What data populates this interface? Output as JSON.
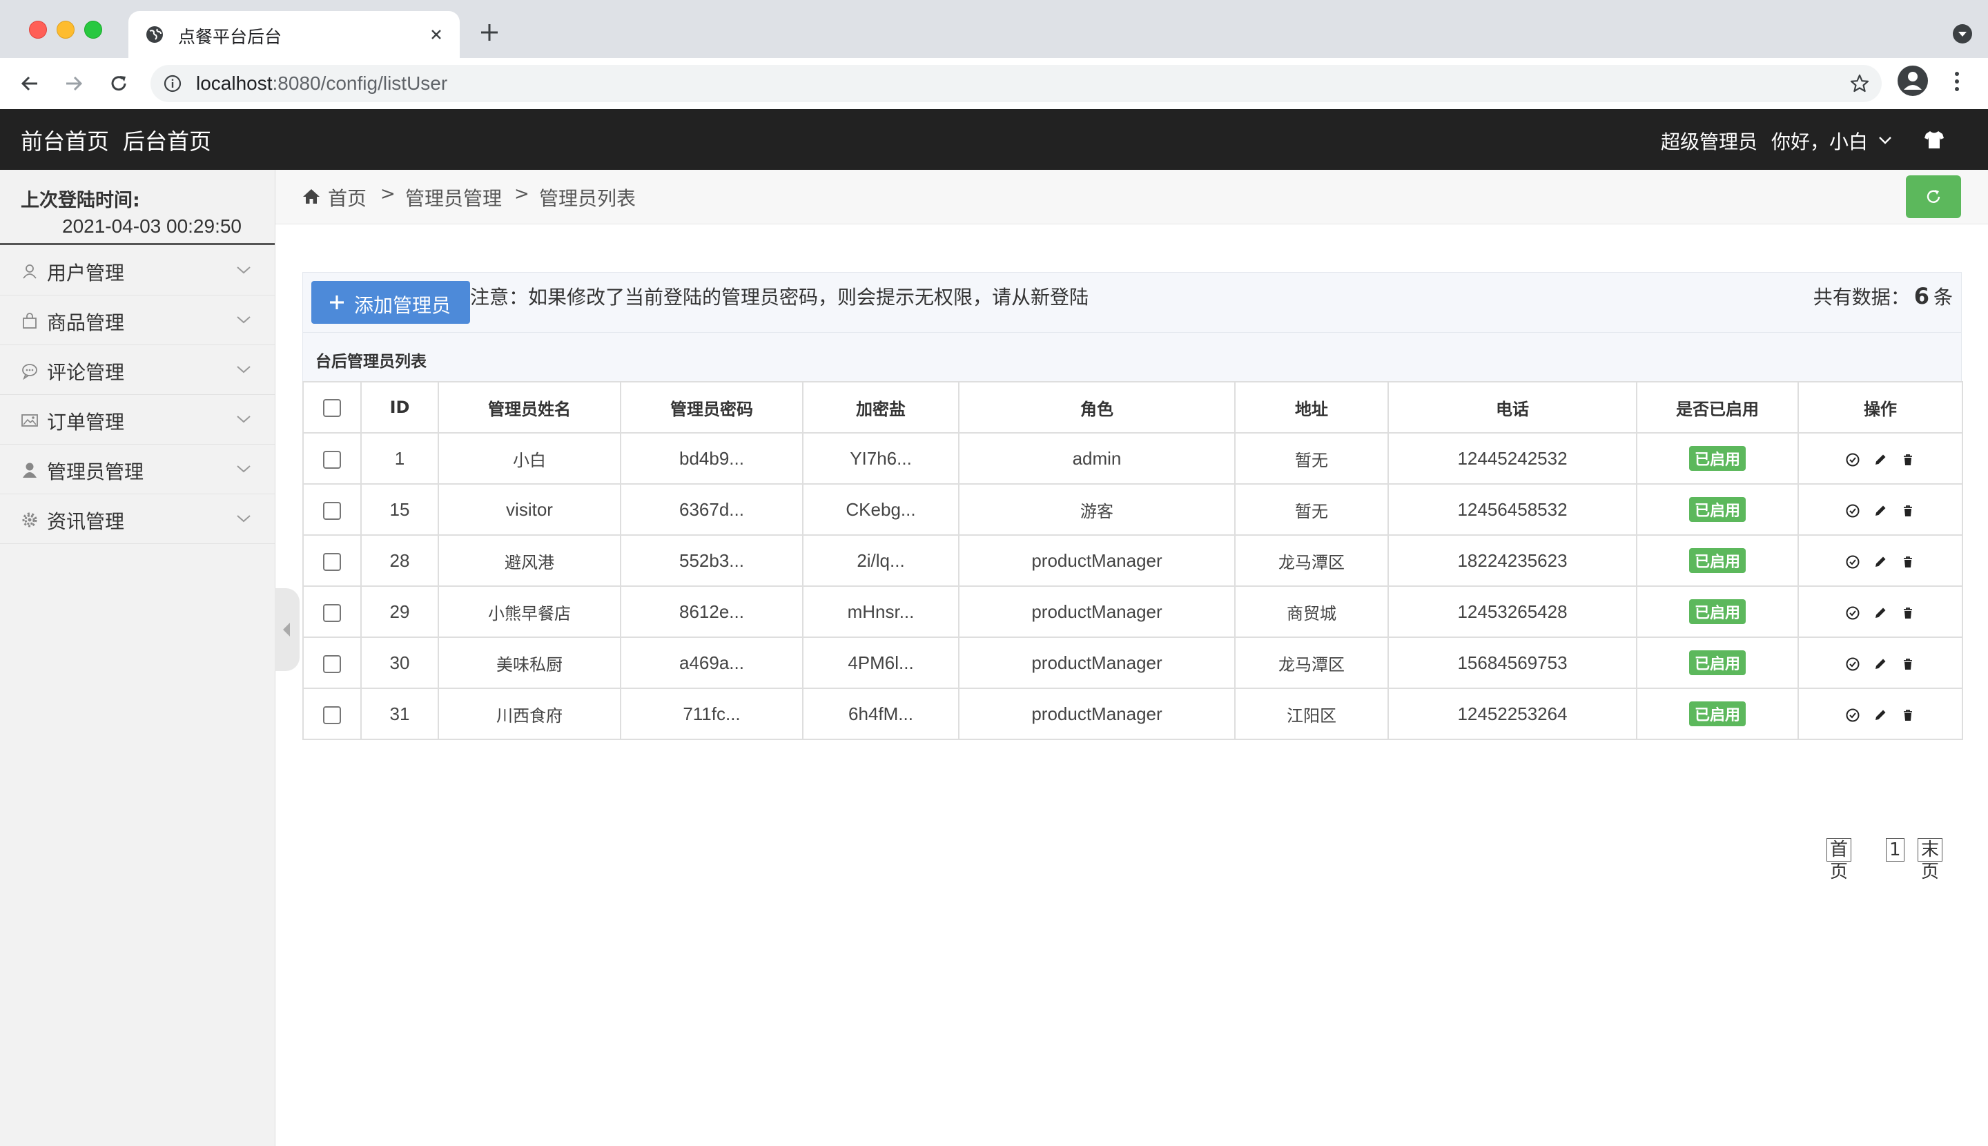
{
  "browser": {
    "tab_title": "点餐平台后台",
    "url_host": "localhost",
    "url_rest": ":8080/config/listUser"
  },
  "header": {
    "nav": [
      "前台首页",
      "后台首页"
    ],
    "role": "超级管理员",
    "greeting": "你好，小白"
  },
  "sidebar": {
    "last_login_label": "上次登陆时间:",
    "last_login_time": "2021-04-03 00:29:50",
    "items": [
      {
        "label": "用户管理",
        "icon": "user-icon"
      },
      {
        "label": "商品管理",
        "icon": "bag-icon"
      },
      {
        "label": "评论管理",
        "icon": "comment-icon"
      },
      {
        "label": "订单管理",
        "icon": "image-icon"
      },
      {
        "label": "管理员管理",
        "icon": "admin-user-icon"
      },
      {
        "label": "资讯管理",
        "icon": "gear-icon"
      }
    ]
  },
  "breadcrumb": {
    "home": "首页",
    "sep": ">",
    "level1": "管理员管理",
    "level2": "管理员列表"
  },
  "toolbar": {
    "add_label": "添加管理员",
    "notice": "注意：如果修改了当前登陆的管理员密码，则会提示无权限，请从新登陆",
    "total_prefix": "共有数据：",
    "total_count": "6",
    "total_suffix": "条"
  },
  "table": {
    "caption": "台后管理员列表",
    "columns": [
      "ID",
      "管理员姓名",
      "管理员密码",
      "加密盐",
      "角色",
      "地址",
      "电话",
      "是否已启用",
      "操作"
    ],
    "rows": [
      {
        "id": "1",
        "name": "小白",
        "password": "bd4b9...",
        "salt": "YI7h6...",
        "role": "admin",
        "address": "暂无",
        "phone": "12445242532",
        "status": "已启用"
      },
      {
        "id": "15",
        "name": "visitor",
        "password": "6367d...",
        "salt": "CKebg...",
        "role": "游客",
        "address": "暂无",
        "phone": "12456458532",
        "status": "已启用"
      },
      {
        "id": "28",
        "name": "避风港",
        "password": "552b3...",
        "salt": "2i/lq...",
        "role": "productManager",
        "address": "龙马潭区",
        "phone": "18224235623",
        "status": "已启用"
      },
      {
        "id": "29",
        "name": "小熊早餐店",
        "password": "8612e...",
        "salt": "mHnsr...",
        "role": "productManager",
        "address": "商贸城",
        "phone": "12453265428",
        "status": "已启用"
      },
      {
        "id": "30",
        "name": "美味私厨",
        "password": "a469a...",
        "salt": "4PM6l...",
        "role": "productManager",
        "address": "龙马潭区",
        "phone": "15684569753",
        "status": "已启用"
      },
      {
        "id": "31",
        "name": "川西食府",
        "password": "711fc...",
        "salt": "6h4fM...",
        "role": "productManager",
        "address": "江阳区",
        "phone": "12452253264",
        "status": "已启用"
      }
    ]
  },
  "pager": {
    "first": "首页",
    "page": "1",
    "last": "末页"
  },
  "colors": {
    "header_bg": "#222222",
    "accent_blue": "#4d8ad9",
    "success_green": "#5cb85c"
  }
}
